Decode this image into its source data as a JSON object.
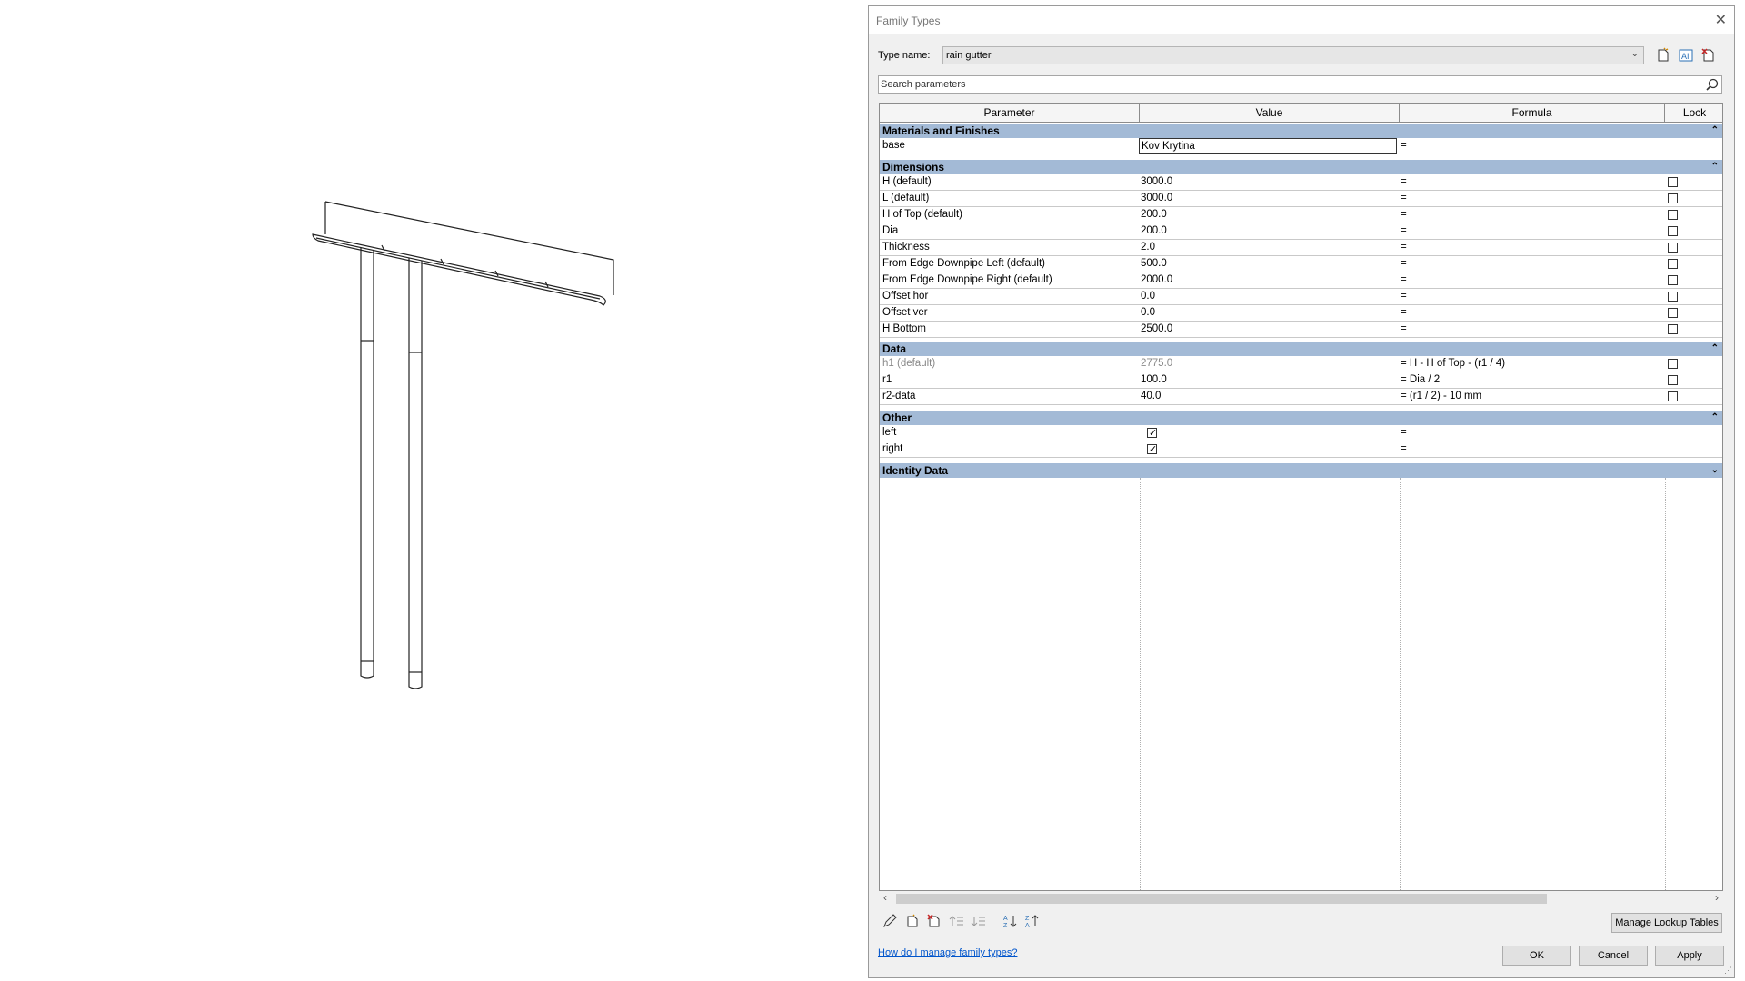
{
  "dialog": {
    "title": "Family Types",
    "type_name_label": "Type name:",
    "type_name_value": "rain gutter",
    "search_placeholder": "Search parameters"
  },
  "grid": {
    "headers": [
      "Parameter",
      "Value",
      "Formula",
      "Lock"
    ],
    "groups": [
      {
        "name": "Materials and Finishes",
        "rows": [
          {
            "param": "base",
            "value": "Kov Krytina",
            "formula": "="
          }
        ]
      },
      {
        "name": "Dimensions",
        "rows": [
          {
            "param": "H (default)",
            "value": "3000.0",
            "formula": "="
          },
          {
            "param": "L (default)",
            "value": "3000.0",
            "formula": "="
          },
          {
            "param": "H of Top (default)",
            "value": "200.0",
            "formula": "="
          },
          {
            "param": "Dia",
            "value": "200.0",
            "formula": "="
          },
          {
            "param": "Thickness",
            "value": "2.0",
            "formula": "="
          },
          {
            "param": "From Edge Downpipe Left (default)",
            "value": "500.0",
            "formula": "="
          },
          {
            "param": "From Edge Downpipe Right (default)",
            "value": "2000.0",
            "formula": "="
          },
          {
            "param": "Offset hor",
            "value": "0.0",
            "formula": "="
          },
          {
            "param": "Offset ver",
            "value": "0.0",
            "formula": "="
          },
          {
            "param": "H Bottom",
            "value": "2500.0",
            "formula": "="
          }
        ]
      },
      {
        "name": "Data",
        "rows": [
          {
            "param": "h1 (default)",
            "value": "2775.0",
            "formula": "= H - H of Top - (r1 / 4)"
          },
          {
            "param": "r1",
            "value": "100.0",
            "formula": "= Dia / 2"
          },
          {
            "param": "r2-data",
            "value": "40.0",
            "formula": "= (r1 / 2) - 10 mm"
          }
        ]
      },
      {
        "name": "Other",
        "rows": [
          {
            "param": "left",
            "value": "",
            "formula": "="
          },
          {
            "param": "right",
            "value": "",
            "formula": "="
          }
        ]
      },
      {
        "name": "Identity Data",
        "rows": []
      }
    ]
  },
  "buttons": {
    "manage_lookup": "Manage Lookup Tables",
    "ok": "OK",
    "cancel": "Cancel",
    "apply": "Apply"
  },
  "help_link": "How do I manage family types?",
  "colors": {
    "group_header": "#a3bad6",
    "link": "#0055cc"
  }
}
